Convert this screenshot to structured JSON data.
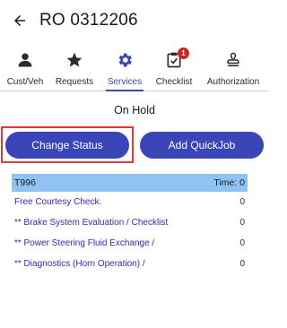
{
  "header": {
    "title": "RO 0312206",
    "back_icon": "arrow-left-icon"
  },
  "tabs": [
    {
      "label": "Cust/Veh",
      "icon": "person-icon",
      "active": false
    },
    {
      "label": "Requests",
      "icon": "star-icon",
      "active": false
    },
    {
      "label": "Services",
      "icon": "gear-icon",
      "active": true
    },
    {
      "label": "Checklist",
      "icon": "checklist-icon",
      "active": false,
      "badge": "1"
    },
    {
      "label": "Authorization",
      "icon": "stamp-icon",
      "active": false
    }
  ],
  "status": {
    "text": "On Hold"
  },
  "actions": {
    "change_status_label": "Change Status",
    "add_quickjob_label": "Add QuickJob"
  },
  "job_list": {
    "header_code": "T996",
    "header_time": "Time: 0",
    "rows": [
      {
        "name": "Free Courtesy Check.",
        "value": "0"
      },
      {
        "name": "** Brake System Evaluation / Checklist",
        "value": "0"
      },
      {
        "name": "** Power Steering Fluid Exchange /",
        "value": "0"
      },
      {
        "name": "** Diagnostics (Horn Operation) /",
        "value": "0"
      }
    ]
  },
  "colors": {
    "accent": "#3a45b7",
    "highlight": "#e53935",
    "list_header_bg": "#90c2f3",
    "badge": "#c62828",
    "link_text": "#2c2cb0"
  }
}
